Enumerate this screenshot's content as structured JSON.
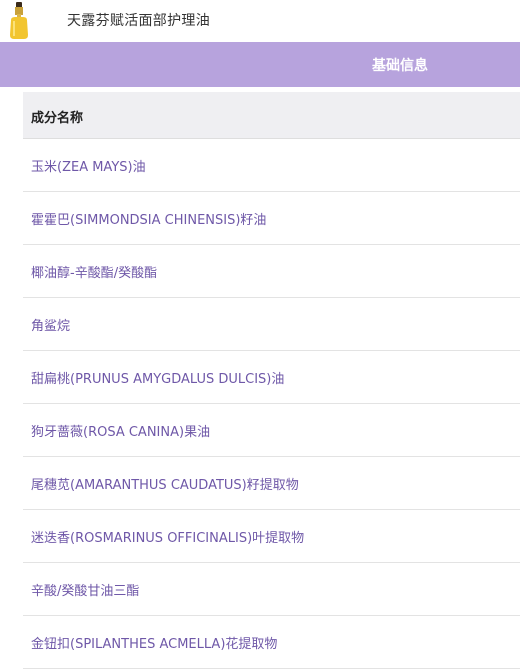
{
  "header": {
    "title": "天露芬赋活面部护理油",
    "thumb_icon": "oil-dropper-bottle-icon"
  },
  "tabs": {
    "active_label": "基础信息"
  },
  "colors": {
    "tab_bar": "#b7a3dd",
    "ingredient_text": "#6f58a8",
    "header_row_bg": "#efeff2"
  },
  "table": {
    "column_header": "成分名称",
    "rows": [
      "玉米(ZEA MAYS)油",
      "霍霍巴(SIMMONDSIA CHINENSIS)籽油",
      "椰油醇-辛酸酯/癸酸酯",
      "角鲨烷",
      "甜扁桃(PRUNUS AMYGDALUS DULCIS)油",
      "狗牙蔷薇(ROSA CANINA)果油",
      "尾穗苋(AMARANTHUS CAUDATUS)籽提取物",
      "迷迭香(ROSMARINUS OFFICINALIS)叶提取物",
      "辛酸/癸酸甘油三酯",
      "金钮扣(SPILANTHES ACMELLA)花提取物"
    ]
  }
}
